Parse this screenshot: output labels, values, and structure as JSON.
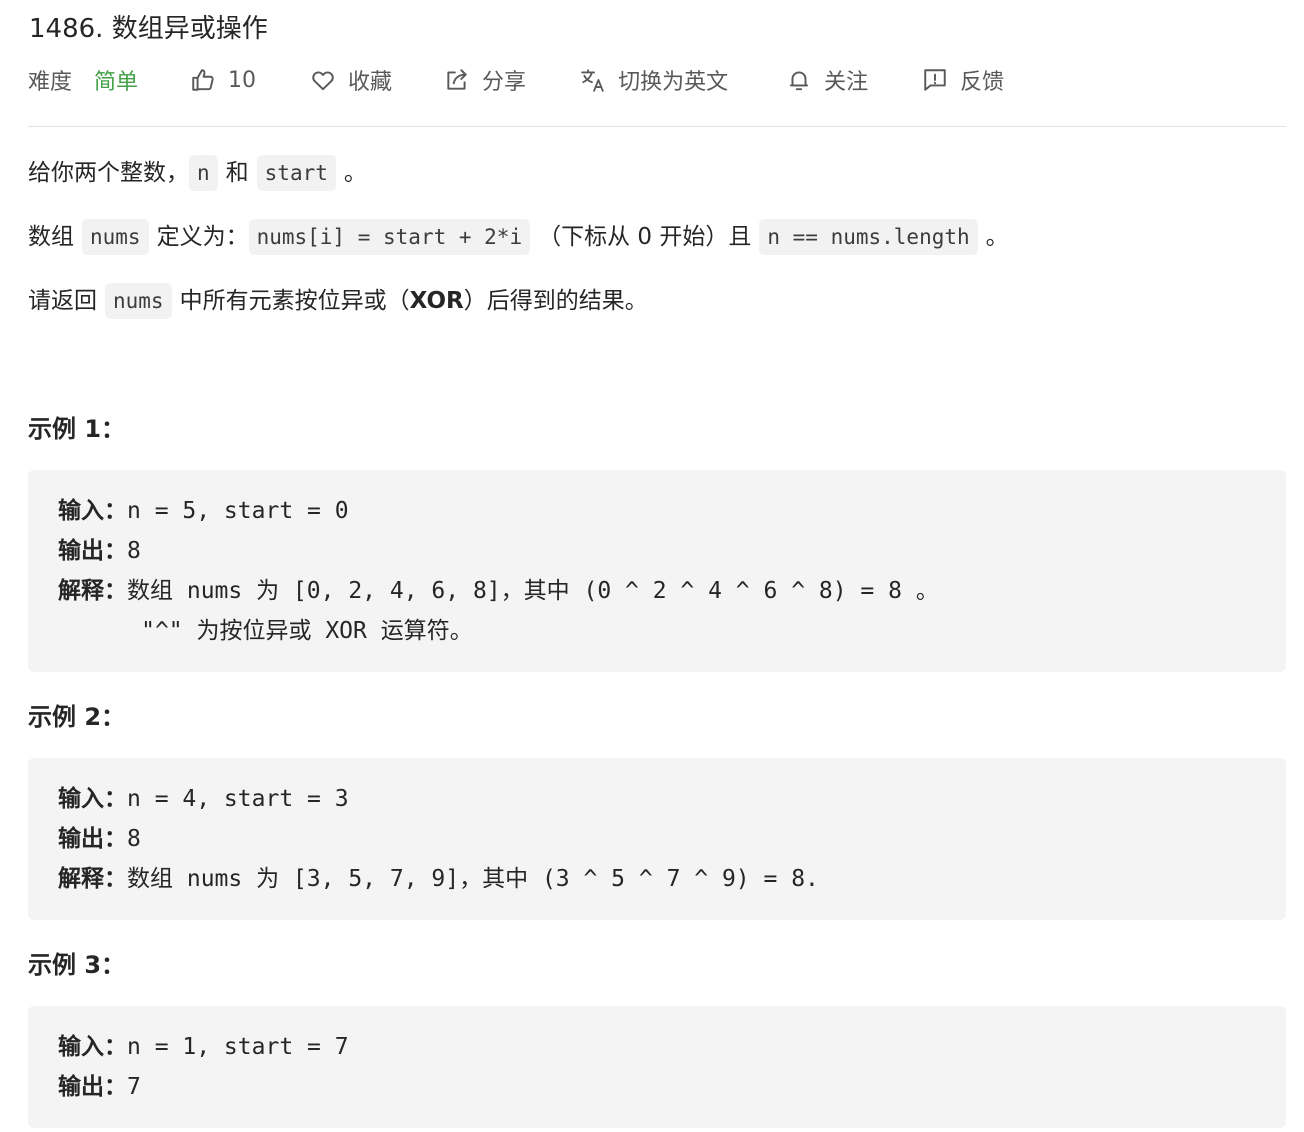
{
  "problem": {
    "title": "1486. 数组异或操作"
  },
  "meta": {
    "difficulty_label": "难度",
    "difficulty_value": "简单",
    "likes": "10",
    "favorite": "收藏",
    "share": "分享",
    "switch_language": "切换为英文",
    "follow": "关注",
    "feedback": "反馈",
    "colors": {
      "easy": "#43a047"
    }
  },
  "description": {
    "p1": {
      "t1": "给你两个整数，",
      "code1": "n",
      "t2": "和",
      "code2": "start",
      "t3": "。"
    },
    "p2": {
      "t1": "数组",
      "code1": "nums",
      "t2": "定义为：",
      "code2": "nums[i] = start + 2*i",
      "t3": "（下标从 0 开始）且",
      "code3": "n == nums.length",
      "t4": "。"
    },
    "p3": {
      "t1": "请返回",
      "code1": "nums",
      "t2": "中所有元素按位异或（",
      "bold": "XOR",
      "t3": "）后得到的结果。"
    }
  },
  "examples": [
    {
      "title": "示例 1：",
      "input_label": "输入：",
      "input": "n = 5, start = 0",
      "output_label": "输出：",
      "output": "8",
      "explain_label": "解释：",
      "explain": "数组 nums 为 [0, 2, 4, 6, 8]，其中 (0 ^ 2 ^ 4 ^ 6 ^ 8) = 8 。",
      "explain2": "\"^\" 为按位异或 XOR 运算符。"
    },
    {
      "title": "示例 2：",
      "input_label": "输入：",
      "input": "n = 4, start = 3",
      "output_label": "输出：",
      "output": "8",
      "explain_label": "解释：",
      "explain": "数组 nums 为 [3, 5, 7, 9]，其中 (3 ^ 5 ^ 7 ^ 9) = 8."
    },
    {
      "title": "示例 3：",
      "input_label": "输入：",
      "input": "n = 1, start = 7",
      "output_label": "输出：",
      "output": "7"
    }
  ]
}
